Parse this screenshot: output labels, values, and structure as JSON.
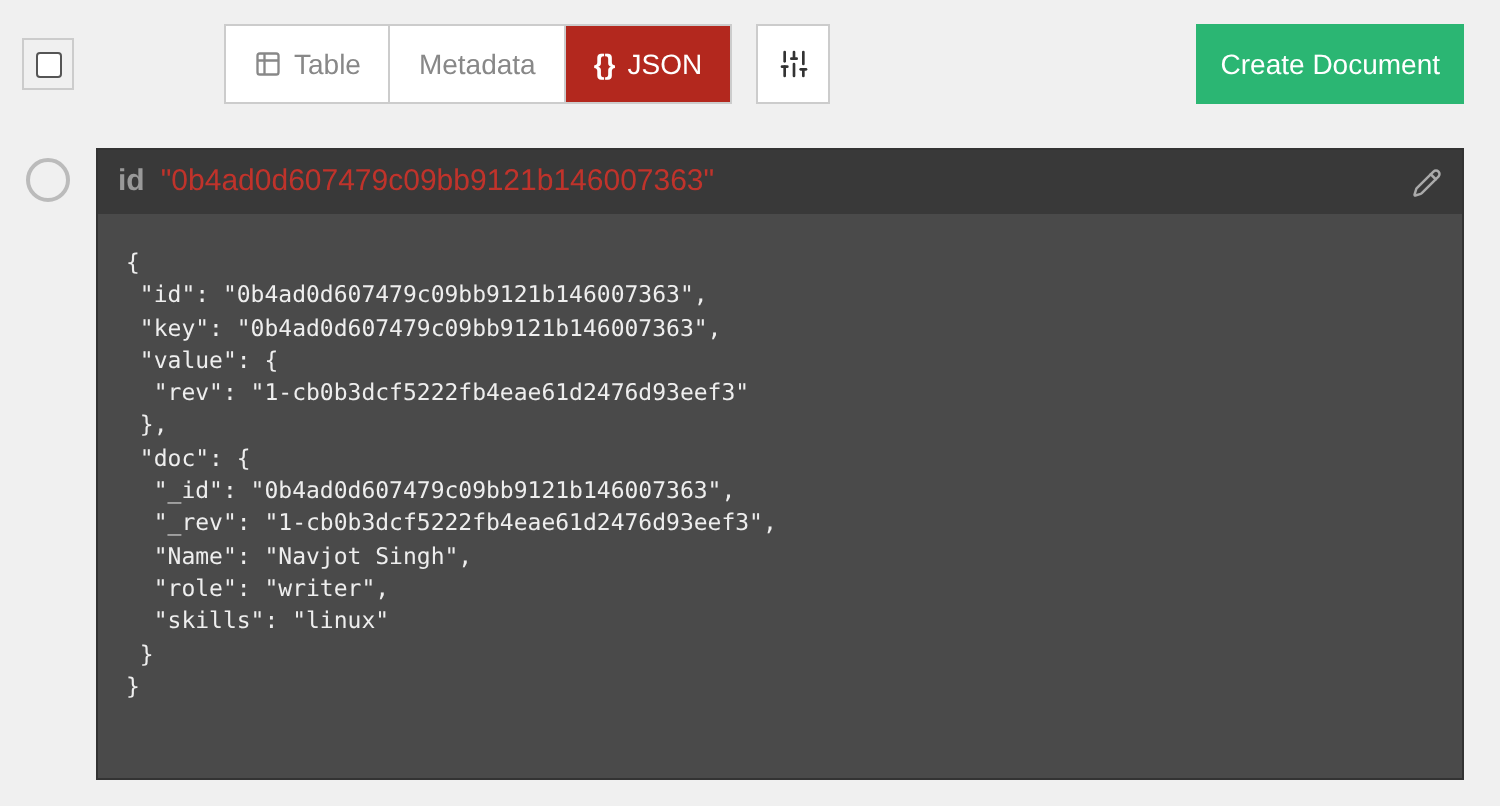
{
  "select_all": {
    "checked": false
  },
  "view_tabs": [
    {
      "kind": "table",
      "label": "Table",
      "selected": false
    },
    {
      "kind": "metadata",
      "label": "Metadata",
      "selected": false
    },
    {
      "kind": "json",
      "symbol": "{}",
      "label": "JSON",
      "selected": true
    }
  ],
  "create_button": "Create Document",
  "documents": [
    {
      "selected": false,
      "id_label": "id",
      "id_value": "\"0b4ad0d607479c09bb9121b146007363\"",
      "lines": [
        "{",
        " \"id\": \"0b4ad0d607479c09bb9121b146007363\",",
        " \"key\": \"0b4ad0d607479c09bb9121b146007363\",",
        " \"value\": {",
        "  \"rev\": \"1-cb0b3dcf5222fb4eae61d2476d93eef3\"",
        " },",
        " \"doc\": {",
        "  \"_id\": \"0b4ad0d607479c09bb9121b146007363\",",
        "  \"_rev\": \"1-cb0b3dcf5222fb4eae61d2476d93eef3\",",
        "  \"Name\": \"Navjot Singh\",",
        "  \"role\": \"writer\",",
        "  \"skills\": \"linux\"",
        " }",
        "}"
      ]
    }
  ]
}
